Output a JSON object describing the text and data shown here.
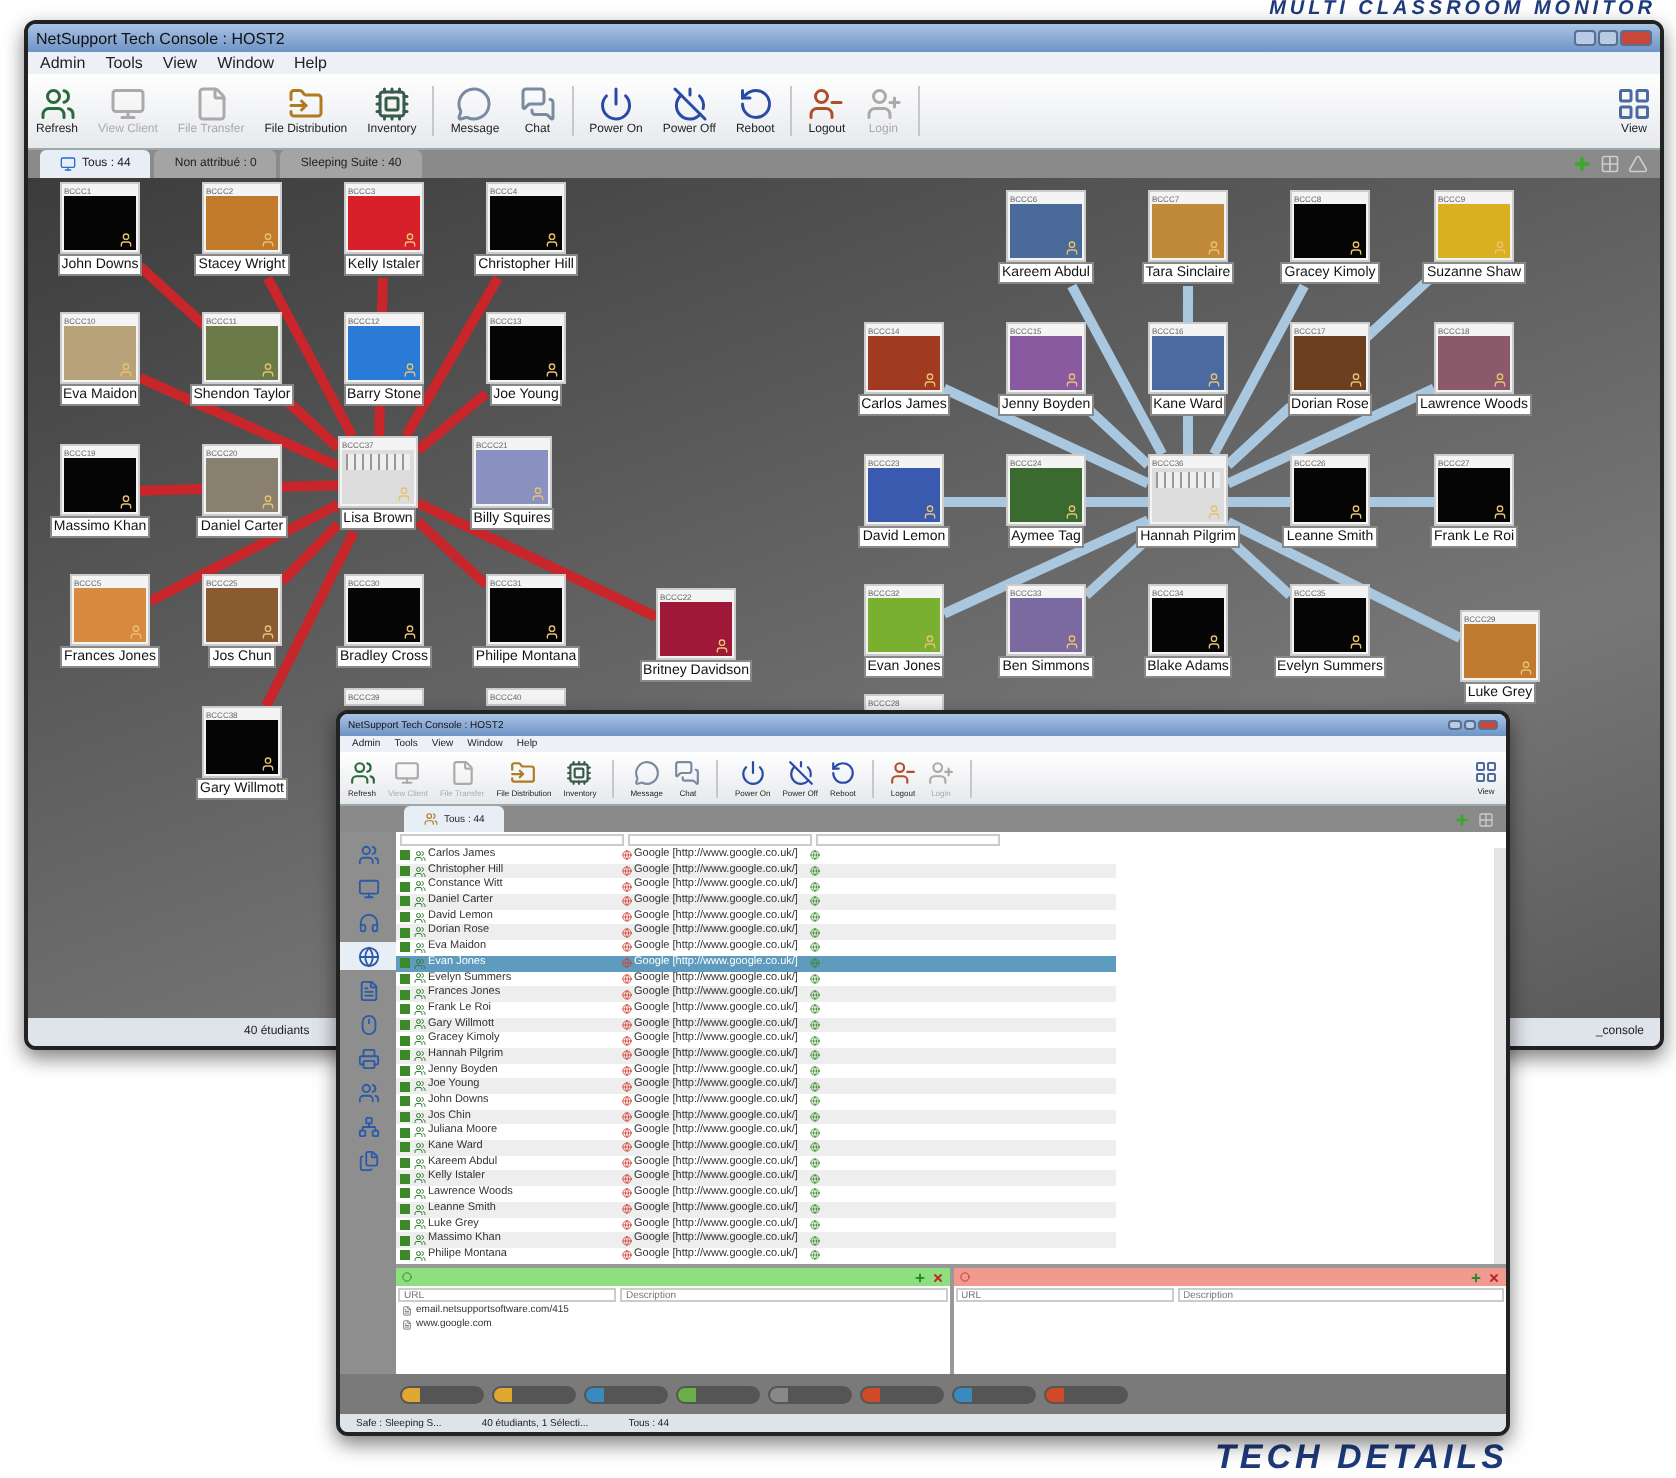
{
  "headline": "MULTI CLASSROOM MONITOR",
  "monitor_window": {
    "title": "NetSupport Tech Console : HOST2",
    "menu": [
      "Admin",
      "Tools",
      "View",
      "Window",
      "Help"
    ],
    "toolbar": [
      [
        {
          "label": "Refresh",
          "disabled": false
        },
        {
          "label": "View Client",
          "disabled": true
        },
        {
          "label": "File Transfer",
          "disabled": true
        },
        {
          "label": "File Distribution",
          "disabled": false
        },
        {
          "label": "Inventory",
          "disabled": false
        }
      ],
      [
        {
          "label": "Message",
          "disabled": false
        },
        {
          "label": "Chat",
          "disabled": false
        }
      ],
      [
        {
          "label": "Power On",
          "disabled": false
        },
        {
          "label": "Power Off",
          "disabled": false
        },
        {
          "label": "Reboot",
          "disabled": false
        }
      ],
      [
        {
          "label": "Logout",
          "disabled": false
        },
        {
          "label": "Login",
          "disabled": true
        }
      ]
    ],
    "view_button": "View",
    "tabs": [
      {
        "label": "Tous : 44",
        "selected": true
      },
      {
        "label": "Non attribué : 0",
        "selected": false
      },
      {
        "label": "Sleeping Suite : 40",
        "selected": false
      }
    ],
    "groups": [
      {
        "hub": {
          "code": "BCCC37",
          "name": "Lisa Brown",
          "screen": {
            "kind": "app"
          }
        },
        "nodes": [
          {
            "code": "BCCC1",
            "name": "John Downs",
            "screen": {
              "kind": "idle"
            }
          },
          {
            "code": "BCCC2",
            "name": "Stacey Wright",
            "screen": {
              "kind": "photo",
              "color": "#c07a2a"
            }
          },
          {
            "code": "BCCC3",
            "name": "Kelly Istaler",
            "screen": {
              "kind": "photo",
              "color": "#d8202a"
            }
          },
          {
            "code": "BCCC4",
            "name": "Christopher Hill",
            "screen": {
              "kind": "idle"
            }
          },
          {
            "code": "BCCC10",
            "name": "Eva Maidon",
            "screen": {
              "kind": "photo",
              "color": "#b8a27a"
            }
          },
          {
            "code": "BCCC11",
            "name": "Shendon Taylor",
            "screen": {
              "kind": "photo",
              "color": "#6a7a48"
            }
          },
          {
            "code": "BCCC12",
            "name": "Barry Stone",
            "screen": {
              "kind": "photo",
              "color": "#2a7ad8"
            }
          },
          {
            "code": "BCCC13",
            "name": "Joe Young",
            "screen": {
              "kind": "idle"
            }
          },
          {
            "code": "BCCC19",
            "name": "Massimo Khan",
            "screen": {
              "kind": "idle"
            }
          },
          {
            "code": "BCCC20",
            "name": "Daniel Carter",
            "screen": {
              "kind": "photo",
              "color": "#8a8070"
            }
          },
          {
            "code": "BCCC21",
            "name": "Billy Squires",
            "screen": {
              "kind": "photo",
              "color": "#8a90c0"
            }
          },
          {
            "code": "BCCC5",
            "name": "Frances Jones",
            "screen": {
              "kind": "photo",
              "color": "#d88a40"
            }
          },
          {
            "code": "BCCC25",
            "name": "Jos Chun",
            "screen": {
              "kind": "photo",
              "color": "#8a5a30"
            }
          },
          {
            "code": "BCCC30",
            "name": "Bradley Cross",
            "screen": {
              "kind": "idle"
            }
          },
          {
            "code": "BCCC31",
            "name": "Philipe Montana",
            "screen": {
              "kind": "idle"
            }
          },
          {
            "code": "BCCC22",
            "name": "Britney Davidson",
            "screen": {
              "kind": "photo",
              "color": "#a01838"
            }
          },
          {
            "code": "BCCC38",
            "name": "Gary Willmott",
            "screen": {
              "kind": "idle"
            }
          },
          {
            "code": "BCCC39"
          },
          {
            "code": "BCCC40"
          }
        ]
      },
      {
        "hub": {
          "code": "BCCC36",
          "name": "Hannah Pilgrim",
          "screen": {
            "kind": "app"
          }
        },
        "nodes": [
          {
            "code": "BCCC6",
            "name": "Kareem Abdul",
            "screen": {
              "kind": "photo",
              "color": "#4a6a9a"
            }
          },
          {
            "code": "BCCC7",
            "name": "Tara Sinclaire",
            "screen": {
              "kind": "photo",
              "color": "#c08a3a"
            }
          },
          {
            "code": "BCCC8",
            "name": "Gracey Kimoly",
            "screen": {
              "kind": "idle"
            }
          },
          {
            "code": "BCCC9",
            "name": "Suzanne Shaw",
            "screen": {
              "kind": "photo",
              "color": "#d8b020"
            }
          },
          {
            "code": "BCCC14",
            "name": "Carlos James",
            "screen": {
              "kind": "photo",
              "color": "#a03a20"
            }
          },
          {
            "code": "BCCC15",
            "name": "Jenny Boyden",
            "screen": {
              "kind": "photo",
              "color": "#8a5aa0"
            }
          },
          {
            "code": "BCCC16",
            "name": "Kane Ward",
            "screen": {
              "kind": "photo",
              "color": "#4a6aa0"
            }
          },
          {
            "code": "BCCC17",
            "name": "Dorian Rose",
            "screen": {
              "kind": "photo",
              "color": "#6a4020"
            }
          },
          {
            "code": "BCCC18",
            "name": "Lawrence Woods",
            "screen": {
              "kind": "photo",
              "color": "#8a5a6a"
            }
          },
          {
            "code": "BCCC23",
            "name": "David Lemon",
            "screen": {
              "kind": "photo",
              "color": "#3a5ab0"
            }
          },
          {
            "code": "BCCC24",
            "name": "Aymee Tag",
            "screen": {
              "kind": "photo",
              "color": "#3a6a30"
            }
          },
          {
            "code": "BCCC26",
            "name": "Leanne Smith",
            "screen": {
              "kind": "idle"
            }
          },
          {
            "code": "BCCC27",
            "name": "Frank Le Roi",
            "screen": {
              "kind": "idle"
            }
          },
          {
            "code": "BCCC32",
            "name": "Evan Jones",
            "screen": {
              "kind": "photo",
              "color": "#7ab030"
            }
          },
          {
            "code": "BCCC33",
            "name": "Ben Simmons",
            "screen": {
              "kind": "photo",
              "color": "#7a6aa0"
            }
          },
          {
            "code": "BCCC34",
            "name": "Blake Adams",
            "screen": {
              "kind": "idle"
            }
          },
          {
            "code": "BCCC35",
            "name": "Evelyn Summers",
            "screen": {
              "kind": "idle"
            }
          },
          {
            "code": "BCCC29",
            "name": "Luke Grey",
            "screen": {
              "kind": "photo",
              "color": "#c07a30"
            }
          },
          {
            "code": "BCCC28"
          }
        ]
      }
    ],
    "status_bar": {
      "count": "40 étudiants",
      "mode": "_console"
    }
  },
  "details_window": {
    "title": "NetSupport Tech Console : HOST2",
    "menu": [
      "Admin",
      "Tools",
      "View",
      "Window",
      "Help"
    ],
    "toolbar": [
      [
        {
          "label": "Refresh",
          "disabled": false
        },
        {
          "label": "View Client",
          "disabled": true
        },
        {
          "label": "File Transfer",
          "disabled": true
        },
        {
          "label": "File Distribution",
          "disabled": false
        },
        {
          "label": "Inventory",
          "disabled": false
        }
      ],
      [
        {
          "label": "Message",
          "disabled": false
        },
        {
          "label": "Chat",
          "disabled": false
        }
      ],
      [
        {
          "label": "Power On",
          "disabled": false
        },
        {
          "label": "Power Off",
          "disabled": false
        },
        {
          "label": "Reboot",
          "disabled": false
        }
      ],
      [
        {
          "label": "Logout",
          "disabled": false
        },
        {
          "label": "Login",
          "disabled": true
        }
      ]
    ],
    "view_button": "View",
    "tabs": [
      {
        "label": "Tous : 44",
        "selected": true
      }
    ],
    "sidebar": [
      {
        "selected": false
      },
      {
        "selected": false
      },
      {
        "selected": false
      },
      {
        "selected": true
      },
      {
        "selected": false
      },
      {
        "selected": false
      },
      {
        "selected": false
      },
      {
        "selected": false
      },
      {
        "selected": false
      },
      {
        "selected": false
      }
    ],
    "rows": [
      {
        "checked": true,
        "name": "Carlos James",
        "site": "Google [http://www.google.co.uk/]",
        "selected": false
      },
      {
        "checked": true,
        "name": "Christopher Hill",
        "site": "Google [http://www.google.co.uk/]",
        "selected": false
      },
      {
        "checked": true,
        "name": "Constance Witt",
        "site": "Google [http://www.google.co.uk/]",
        "selected": false
      },
      {
        "checked": true,
        "name": "Daniel Carter",
        "site": "Google [http://www.google.co.uk/]",
        "selected": false
      },
      {
        "checked": true,
        "name": "David Lemon",
        "site": "Google [http://www.google.co.uk/]",
        "selected": false
      },
      {
        "checked": true,
        "name": "Dorian Rose",
        "site": "Google [http://www.google.co.uk/]",
        "selected": false
      },
      {
        "checked": true,
        "name": "Eva Maidon",
        "site": "Google [http://www.google.co.uk/]",
        "selected": false
      },
      {
        "checked": true,
        "name": "Evan Jones",
        "site": "Google [http://www.google.co.uk/]",
        "selected": true
      },
      {
        "checked": true,
        "name": "Evelyn Summers",
        "site": "Google [http://www.google.co.uk/]",
        "selected": false
      },
      {
        "checked": true,
        "name": "Frances Jones",
        "site": "Google [http://www.google.co.uk/]",
        "selected": false
      },
      {
        "checked": true,
        "name": "Frank Le Roi",
        "site": "Google [http://www.google.co.uk/]",
        "selected": false
      },
      {
        "checked": true,
        "name": "Gary Willmott",
        "site": "Google [http://www.google.co.uk/]",
        "selected": false
      },
      {
        "checked": true,
        "name": "Gracey Kimoly",
        "site": "Google [http://www.google.co.uk/]",
        "selected": false
      },
      {
        "checked": true,
        "name": "Hannah Pilgrim",
        "site": "Google [http://www.google.co.uk/]",
        "selected": false
      },
      {
        "checked": true,
        "name": "Jenny Boyden",
        "site": "Google [http://www.google.co.uk/]",
        "selected": false
      },
      {
        "checked": true,
        "name": "Joe Young",
        "site": "Google [http://www.google.co.uk/]",
        "selected": false
      },
      {
        "checked": true,
        "name": "John Downs",
        "site": "Google [http://www.google.co.uk/]",
        "selected": false
      },
      {
        "checked": true,
        "name": "Jos Chin",
        "site": "Google [http://www.google.co.uk/]",
        "selected": false
      },
      {
        "checked": true,
        "name": "Juliana Moore",
        "site": "Google [http://www.google.co.uk/]",
        "selected": false
      },
      {
        "checked": true,
        "name": "Kane Ward",
        "site": "Google [http://www.google.co.uk/]",
        "selected": false
      },
      {
        "checked": true,
        "name": "Kareem Abdul",
        "site": "Google [http://www.google.co.uk/]",
        "selected": false
      },
      {
        "checked": true,
        "name": "Kelly Istaler",
        "site": "Google [http://www.google.co.uk/]",
        "selected": false
      },
      {
        "checked": true,
        "name": "Lawrence Woods",
        "site": "Google [http://www.google.co.uk/]",
        "selected": false
      },
      {
        "checked": true,
        "name": "Leanne Smith",
        "site": "Google [http://www.google.co.uk/]",
        "selected": false
      },
      {
        "checked": true,
        "name": "Luke Grey",
        "site": "Google [http://www.google.co.uk/]",
        "selected": false
      },
      {
        "checked": true,
        "name": "Massimo Khan",
        "site": "Google [http://www.google.co.uk/]",
        "selected": false
      },
      {
        "checked": true,
        "name": "Philipe Montana",
        "site": "Google [http://www.google.co.uk/]",
        "selected": false
      }
    ],
    "panels": [
      {
        "kind": "allow",
        "url_placeholder": "URL",
        "description_placeholder": "Description",
        "entries": [
          "email.netsupportsoftware.com/415",
          "www.google.com"
        ]
      },
      {
        "kind": "block",
        "url_placeholder": "URL",
        "description_placeholder": "Description"
      }
    ],
    "status_bar": [
      "Safe : Sleeping S...",
      "40 étudiants, 1 Sélecti...",
      "Tous : 44"
    ]
  },
  "caption": "TECH DETAILS"
}
